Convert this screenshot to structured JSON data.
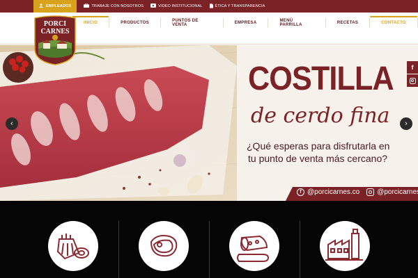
{
  "topbar": {
    "employees": "EMPLEADOS",
    "links": [
      "TRABAJE CON NOSOTROS",
      "VIDEO INSTITUCIONAL",
      "ÉTICA Y TRANSPARENCIA"
    ]
  },
  "logo": {
    "line1": "PORCI",
    "line2": "CARNES"
  },
  "nav": [
    "INICIO",
    "PRODUCTOS",
    "PUNTOS DE VENTA",
    "EMPRESA",
    "MENÚ PARRILLA",
    "RECETAS",
    "CONTACTO"
  ],
  "hero": {
    "headline": "COSTILLA",
    "script": "de cerdo fina",
    "question_line1": "¿Qué esperas para disfrutarla en",
    "question_line2": "tu punto de venta más cercano?",
    "handle1": "@porcicarnes.co",
    "handle2": "@porcicarnes.co"
  },
  "social": {
    "facebook": "f"
  },
  "colors": {
    "maroon": "#7b2226",
    "gold": "#d9a21b"
  }
}
